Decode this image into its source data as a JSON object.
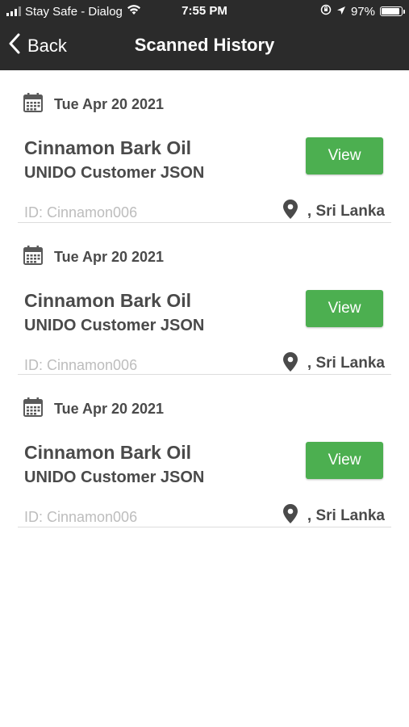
{
  "status_bar": {
    "carrier": "Stay Safe - Dialog",
    "time": "7:55 PM",
    "battery": "97%",
    "battery_level": 0.97,
    "icons": [
      "signal-icon",
      "wifi-icon",
      "lock-rotation-icon",
      "location-arrow-icon",
      "battery-icon"
    ]
  },
  "nav": {
    "back_label": "Back",
    "title": "Scanned History"
  },
  "entries": [
    {
      "date": "Tue Apr 20 2021",
      "name": "Cinnamon Bark Oil",
      "source": "UNIDO Customer JSON",
      "view_label": "View",
      "id": "ID: Cinnamon006",
      "location": ", Sri Lanka"
    },
    {
      "date": "Tue Apr 20 2021",
      "name": "Cinnamon Bark Oil",
      "source": "UNIDO Customer JSON",
      "view_label": "View",
      "id": "ID: Cinnamon006",
      "location": ", Sri Lanka"
    },
    {
      "date": "Tue Apr 20 2021",
      "name": "Cinnamon Bark Oil",
      "source": "UNIDO Customer JSON",
      "view_label": "View",
      "id": "ID: Cinnamon006",
      "location": ", Sri Lanka"
    }
  ],
  "colors": {
    "header_bg": "#2b2b2b",
    "accent_green": "#4caf50",
    "text_dark": "#4a4a4a",
    "text_muted": "#bdbdbd",
    "divider": "#dddddd"
  }
}
